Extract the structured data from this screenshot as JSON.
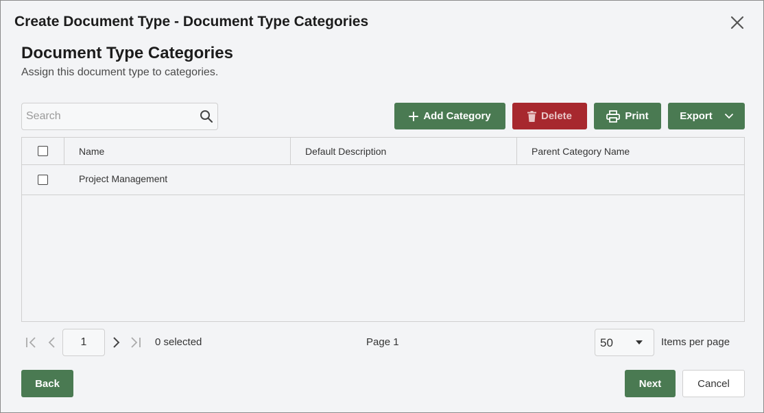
{
  "dialog": {
    "title": "Create Document Type - Document Type Categories"
  },
  "section": {
    "title": "Document Type Categories",
    "subtitle": "Assign this document type to categories."
  },
  "search": {
    "placeholder": "Search",
    "value": ""
  },
  "toolbar": {
    "add_label": "Add Category",
    "delete_label": "Delete",
    "print_label": "Print",
    "export_label": "Export"
  },
  "grid": {
    "columns": [
      "Name",
      "Default Description",
      "Parent Category Name"
    ],
    "rows": [
      {
        "name": "Project Management",
        "description": "",
        "parent": ""
      }
    ]
  },
  "pager": {
    "page_value": "1",
    "selected_text": "0 selected",
    "page_text": "Page 1",
    "page_size": "50",
    "items_per_page_label": "Items per page"
  },
  "footer": {
    "back_label": "Back",
    "next_label": "Next",
    "cancel_label": "Cancel"
  },
  "colors": {
    "primary_green": "#4a7a52",
    "danger_red": "#a7282e",
    "background": "#f3f4f6"
  },
  "icons": [
    "close-icon",
    "search-icon",
    "plus-icon",
    "trash-icon",
    "printer-icon",
    "chevron-down-icon",
    "first-page-icon",
    "prev-page-icon",
    "next-page-icon",
    "last-page-icon"
  ]
}
